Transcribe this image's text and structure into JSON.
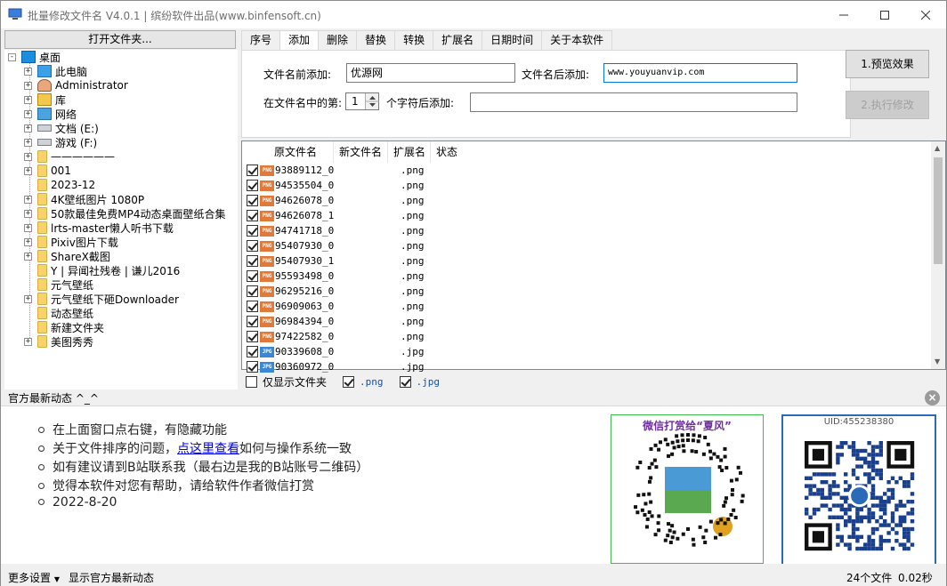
{
  "window": {
    "title": "批量修改文件名 V4.0.1 | 缤纷软件出品(www.binfensoft.cn)"
  },
  "sidebar": {
    "open_folder_label": "打开文件夹...",
    "tree": [
      {
        "label": "桌面",
        "icon": "desktop-icon",
        "level": 0,
        "expander": "-"
      },
      {
        "label": "此电脑",
        "icon": "computer-icon",
        "level": 1,
        "expander": "+"
      },
      {
        "label": "Administrator",
        "icon": "user-icon",
        "level": 1,
        "expander": "+"
      },
      {
        "label": "库",
        "icon": "library-icon",
        "level": 1,
        "expander": "+"
      },
      {
        "label": "网络",
        "icon": "network-icon",
        "level": 1,
        "expander": "+"
      },
      {
        "label": "文档 (E:)",
        "icon": "drive-icon",
        "level": 1,
        "expander": "+"
      },
      {
        "label": "游戏 (F:)",
        "icon": "drive-icon",
        "level": 1,
        "expander": "+"
      },
      {
        "label": "——————",
        "icon": "folder-icon",
        "level": 1,
        "expander": "+"
      },
      {
        "label": "001",
        "icon": "folder-icon",
        "level": 1,
        "expander": "+"
      },
      {
        "label": "2023-12",
        "icon": "folder-icon",
        "level": 1,
        "expander": ""
      },
      {
        "label": "4K壁纸图片 1080P",
        "icon": "folder-icon",
        "level": 1,
        "expander": "+"
      },
      {
        "label": "50款最佳免费MP4动态桌面壁纸合集",
        "icon": "folder-icon",
        "level": 1,
        "expander": "+"
      },
      {
        "label": "lrts-master懒人听书下载",
        "icon": "folder-icon",
        "level": 1,
        "expander": "+"
      },
      {
        "label": "Pixiv图片下载",
        "icon": "folder-icon",
        "level": 1,
        "expander": "+"
      },
      {
        "label": "ShareX截图",
        "icon": "folder-icon",
        "level": 1,
        "expander": "+"
      },
      {
        "label": "Y | 异闻社残卷 | 谦儿2016",
        "icon": "folder-icon",
        "level": 1,
        "expander": ""
      },
      {
        "label": "元气壁纸",
        "icon": "folder-icon",
        "level": 1,
        "expander": ""
      },
      {
        "label": "元气壁纸下砸Downloader",
        "icon": "folder-icon",
        "level": 1,
        "expander": "+"
      },
      {
        "label": "动态壁纸",
        "icon": "folder-icon",
        "level": 1,
        "expander": ""
      },
      {
        "label": "新建文件夹",
        "icon": "folder-icon",
        "level": 1,
        "expander": ""
      },
      {
        "label": "美图秀秀",
        "icon": "folder-icon",
        "level": 1,
        "expander": "+"
      }
    ]
  },
  "tabs": [
    "序号",
    "添加",
    "删除",
    "替换",
    "转换",
    "扩展名",
    "日期时间",
    "关于本软件"
  ],
  "active_tab": "添加",
  "add_panel": {
    "prefix_label": "文件名前添加:",
    "prefix_value": "优源网",
    "suffix_label": "文件名后添加:",
    "suffix_value": "www.youyuanvip.com",
    "position_label": "在文件名中的第:",
    "position_value": "1",
    "after_chars_label": "个字符后添加:",
    "after_chars_value": ""
  },
  "actions": {
    "preview_label": "1.预览效果",
    "execute_label": "2.执行修改"
  },
  "file_list": {
    "columns": [
      "原文件名",
      "新文件名",
      "扩展名",
      "状态"
    ],
    "rows": [
      {
        "name": "93889112_0",
        "ext": ".png",
        "type": "PNG"
      },
      {
        "name": "94535504_0",
        "ext": ".png",
        "type": "PNG"
      },
      {
        "name": "94626078_0",
        "ext": ".png",
        "type": "PNG"
      },
      {
        "name": "94626078_1",
        "ext": ".png",
        "type": "PNG"
      },
      {
        "name": "94741718_0",
        "ext": ".png",
        "type": "PNG"
      },
      {
        "name": "95407930_0",
        "ext": ".png",
        "type": "PNG"
      },
      {
        "name": "95407930_1",
        "ext": ".png",
        "type": "PNG"
      },
      {
        "name": "95593498_0",
        "ext": ".png",
        "type": "PNG"
      },
      {
        "name": "96295216_0",
        "ext": ".png",
        "type": "PNG"
      },
      {
        "name": "96909063_0",
        "ext": ".png",
        "type": "PNG"
      },
      {
        "name": "96984394_0",
        "ext": ".png",
        "type": "PNG"
      },
      {
        "name": "97422582_0",
        "ext": ".png",
        "type": "PNG"
      },
      {
        "name": "90339608_0",
        "ext": ".jpg",
        "type": "JPG"
      },
      {
        "name": "90360972_0",
        "ext": ".jpg",
        "type": "JPG"
      }
    ]
  },
  "filters": {
    "folders_only_label": "仅显示文件夹",
    "png_label": ".png",
    "jpg_label": ".jpg"
  },
  "news": {
    "title": "官方最新动态 ^_^",
    "items": [
      {
        "text_before": "在上面窗口点右键，有隐藏功能",
        "link": "",
        "text_after": ""
      },
      {
        "text_before": "关于文件排序的问题，",
        "link": "点这里查看",
        "text_after": "如何与操作系统一致"
      },
      {
        "text_before": "如有建议请到B站联系我（最右边是我的B站账号二维码）",
        "link": "",
        "text_after": ""
      },
      {
        "text_before": "觉得本软件对您有帮助，请给软件作者微信打赏",
        "link": "",
        "text_after": ""
      },
      {
        "text_before": "2022-8-20",
        "link": "",
        "text_after": ""
      }
    ],
    "qr_wechat_title": "微信打赏给“夏风”",
    "qr_bili_title": "UID:455238380"
  },
  "statusbar": {
    "more_settings": "更多设置",
    "show_news": "显示官方最新动态",
    "file_count": "24个文件",
    "elapsed": "0.02秒"
  }
}
